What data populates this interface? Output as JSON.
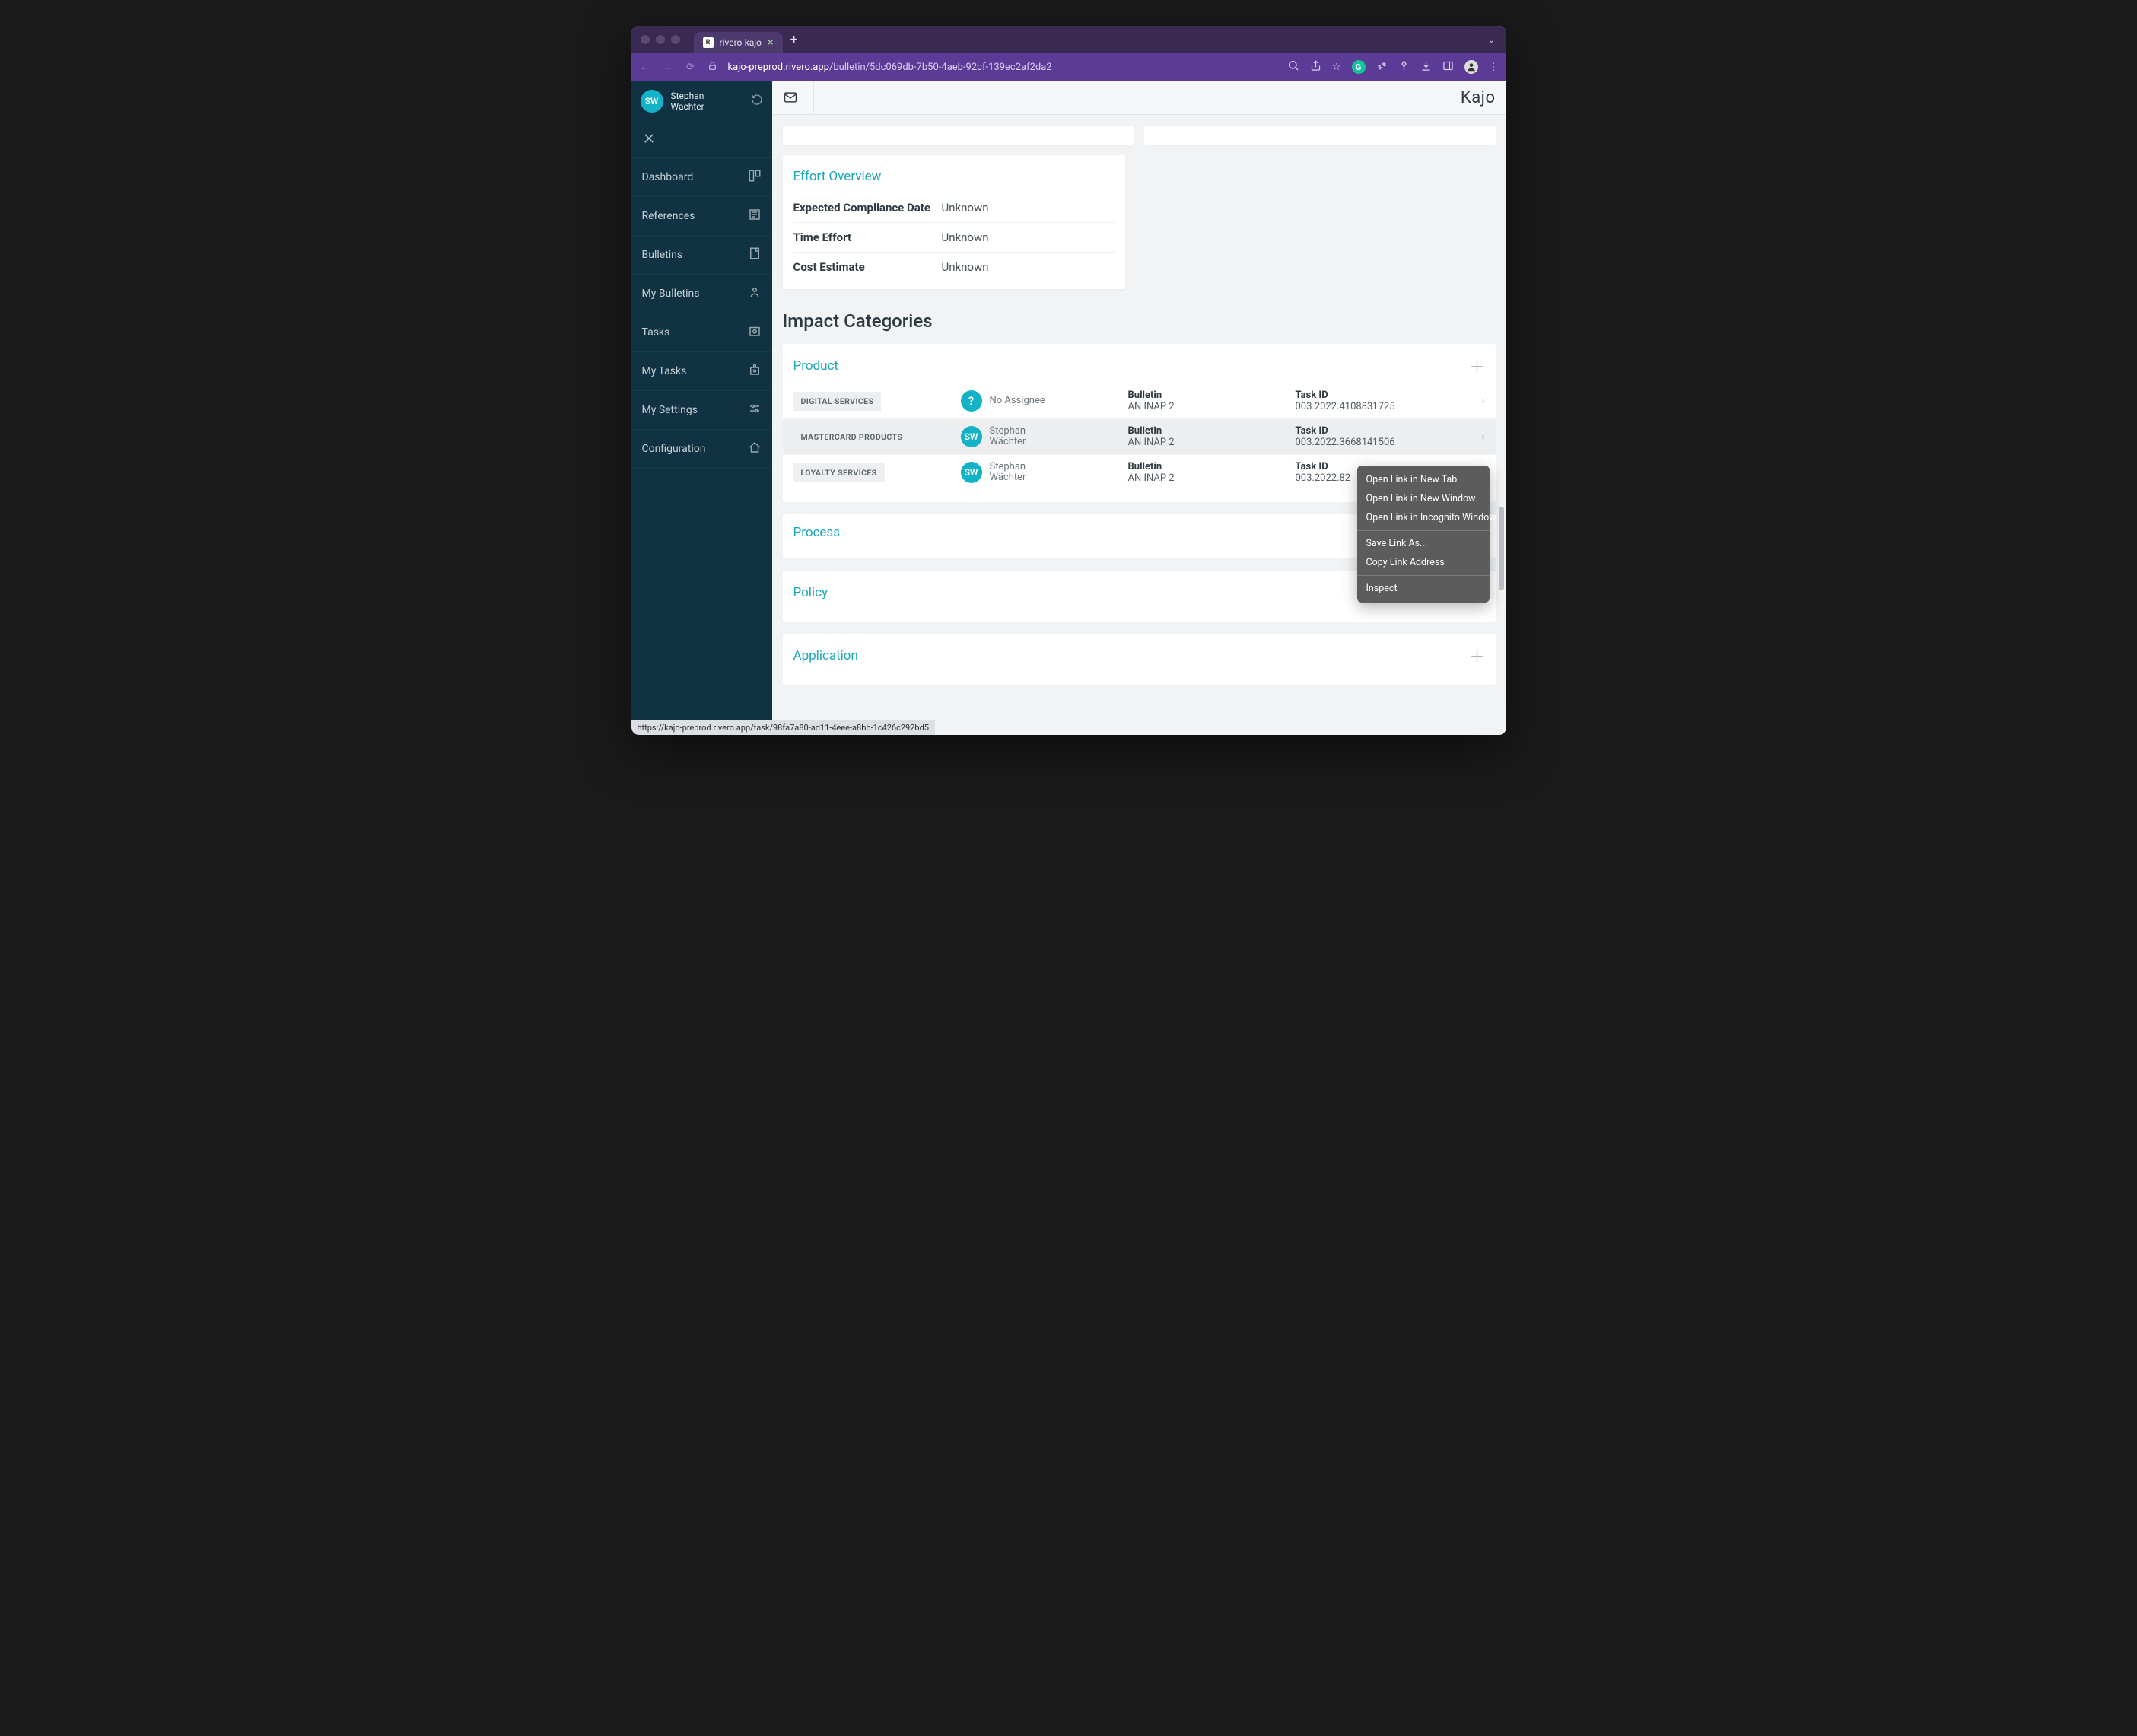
{
  "browser": {
    "tab_title": "rivero-kajo",
    "url_host": "kajo-preprod.rivero.app",
    "url_path": "/bulletin/5dc069db-7b50-4aeb-92cf-139ec2af2da2"
  },
  "sidebar": {
    "user_initials": "SW",
    "user_first": "Stephan",
    "user_last": "Wachter",
    "items": [
      {
        "label": "Dashboard"
      },
      {
        "label": "References"
      },
      {
        "label": "Bulletins"
      },
      {
        "label": "My Bulletins"
      },
      {
        "label": "Tasks"
      },
      {
        "label": "My Tasks"
      },
      {
        "label": "My Settings"
      },
      {
        "label": "Configuration"
      }
    ]
  },
  "header": {
    "brand": "Kajo"
  },
  "effort": {
    "title": "Effort Overview",
    "rows": [
      {
        "k": "Expected Compliance Date",
        "v": "Unknown"
      },
      {
        "k": "Time Effort",
        "v": "Unknown"
      },
      {
        "k": "Cost Estimate",
        "v": "Unknown"
      }
    ]
  },
  "impact": {
    "heading": "Impact Categories",
    "panels": {
      "product": {
        "title": "Product",
        "rows": [
          {
            "tag": "DIGITAL SERVICES",
            "assignee_initials": "?",
            "assignee_name": "No Assignee",
            "assignee_last": "",
            "bulletin_label": "Bulletin",
            "bulletin_value": "AN INAP 2",
            "task_label": "Task ID",
            "task_value": "003.2022.4108831725"
          },
          {
            "tag": "MASTERCARD PRODUCTS",
            "assignee_initials": "SW",
            "assignee_name": "Stephan",
            "assignee_last": "Wächter",
            "bulletin_label": "Bulletin",
            "bulletin_value": "AN INAP 2",
            "task_label": "Task ID",
            "task_value": "003.2022.3668141506"
          },
          {
            "tag": "LOYALTY SERVICES",
            "assignee_initials": "SW",
            "assignee_name": "Stephan",
            "assignee_last": "Wächter",
            "bulletin_label": "Bulletin",
            "bulletin_value": "AN INAP 2",
            "task_label": "Task ID",
            "task_value": "003.2022.82"
          }
        ]
      },
      "process": {
        "title": "Process"
      },
      "policy": {
        "title": "Policy"
      },
      "application": {
        "title": "Application"
      }
    }
  },
  "context_menu": {
    "items": [
      "Open Link in New Tab",
      "Open Link in New Window",
      "Open Link in Incognito Window",
      "Save Link As...",
      "Copy Link Address",
      "Inspect"
    ]
  },
  "status_url": "https://kajo-preprod.rivero.app/task/98fa7a80-ad11-4eee-a8bb-1c426c292bd5"
}
